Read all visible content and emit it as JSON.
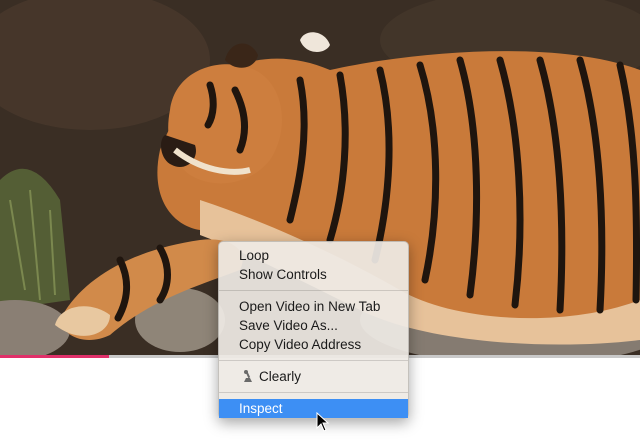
{
  "video": {
    "subject": "tiger lying on rocks",
    "progress_fraction": 0.17
  },
  "context_menu": {
    "groups": [
      [
        {
          "label": "Loop"
        },
        {
          "label": "Show Controls"
        }
      ],
      [
        {
          "label": "Open Video in New Tab"
        },
        {
          "label": "Save Video As..."
        },
        {
          "label": "Copy Video Address"
        }
      ],
      [
        {
          "label": "Clearly",
          "icon": "clearly-extension-icon"
        }
      ],
      [
        {
          "label": "Inspect",
          "highlighted": true
        }
      ]
    ]
  },
  "colors": {
    "progress_fill": "#e0306a",
    "menu_highlight": "#3d8ff4"
  }
}
